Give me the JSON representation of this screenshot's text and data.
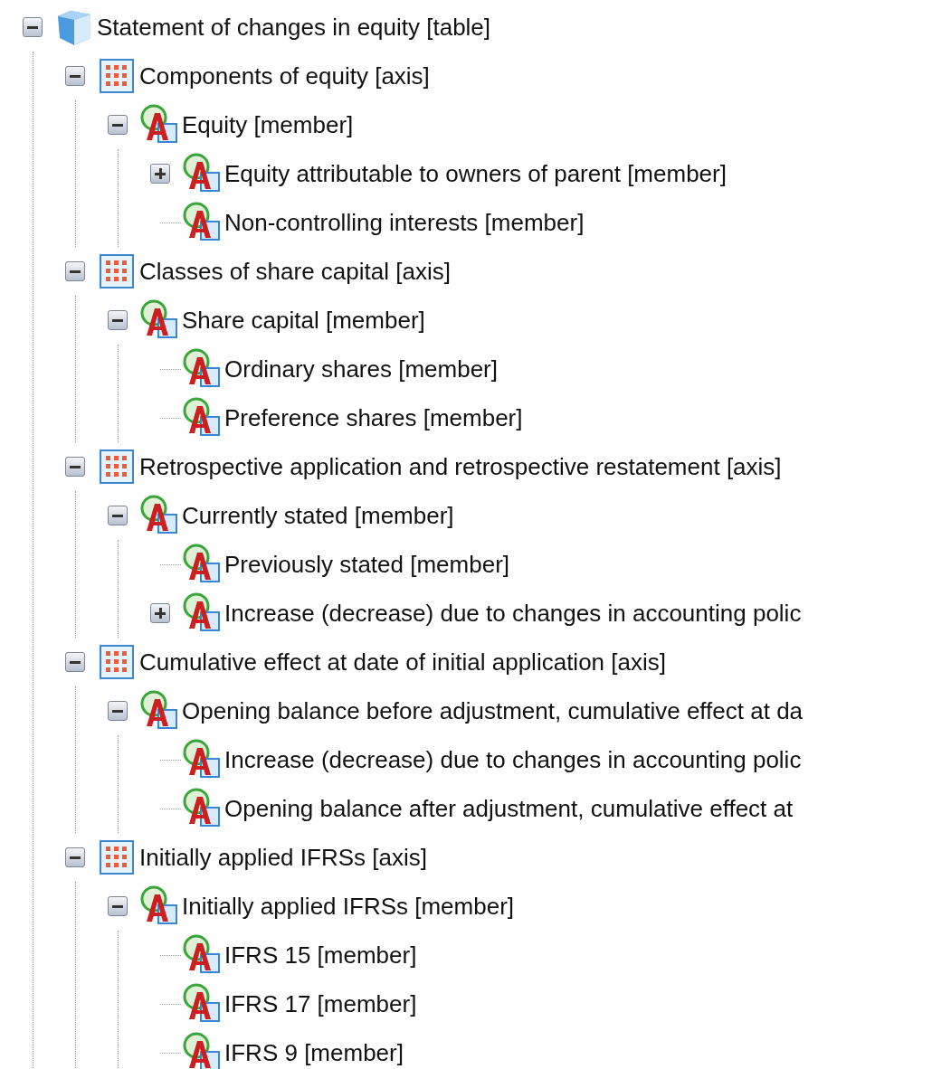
{
  "tree": [
    {
      "kind": "table",
      "label": "Statement of changes in equity [table]",
      "expanded": true,
      "children": [
        {
          "kind": "axis",
          "label": "Components of equity [axis]",
          "expanded": true,
          "children": [
            {
              "kind": "member",
              "label": "Equity [member]",
              "expanded": true,
              "children": [
                {
                  "kind": "member",
                  "label": "Equity attributable to owners of parent [member]",
                  "expanded": false
                },
                {
                  "kind": "member",
                  "label": "Non-controlling interests [member]"
                }
              ]
            }
          ]
        },
        {
          "kind": "axis",
          "label": "Classes of share capital [axis]",
          "expanded": true,
          "children": [
            {
              "kind": "member",
              "label": "Share capital [member]",
              "expanded": true,
              "children": [
                {
                  "kind": "member",
                  "label": "Ordinary shares [member]"
                },
                {
                  "kind": "member",
                  "label": "Preference shares [member]"
                }
              ]
            }
          ]
        },
        {
          "kind": "axis",
          "label": "Retrospective application and retrospective restatement [axis]",
          "expanded": true,
          "children": [
            {
              "kind": "member",
              "label": "Currently stated [member]",
              "expanded": true,
              "children": [
                {
                  "kind": "member",
                  "label": "Previously stated [member]"
                },
                {
                  "kind": "member",
                  "label": "Increase (decrease) due to changes in accounting polic",
                  "expanded": false
                }
              ]
            }
          ]
        },
        {
          "kind": "axis",
          "label": "Cumulative effect at date of initial application [axis]",
          "expanded": true,
          "children": [
            {
              "kind": "member",
              "label": "Opening balance before adjustment, cumulative effect at da",
              "expanded": true,
              "children": [
                {
                  "kind": "member",
                  "label": "Increase (decrease) due to changes in accounting polic"
                },
                {
                  "kind": "member",
                  "label": "Opening balance after adjustment, cumulative effect at"
                }
              ]
            }
          ]
        },
        {
          "kind": "axis",
          "label": "Initially applied IFRSs [axis]",
          "expanded": true,
          "children": [
            {
              "kind": "member",
              "label": "Initially applied IFRSs [member]",
              "expanded": true,
              "children": [
                {
                  "kind": "member",
                  "label": "IFRS 15 [member]"
                },
                {
                  "kind": "member",
                  "label": "IFRS 17 [member]"
                },
                {
                  "kind": "member",
                  "label": "IFRS 9 [member]"
                }
              ]
            }
          ]
        }
      ]
    }
  ]
}
